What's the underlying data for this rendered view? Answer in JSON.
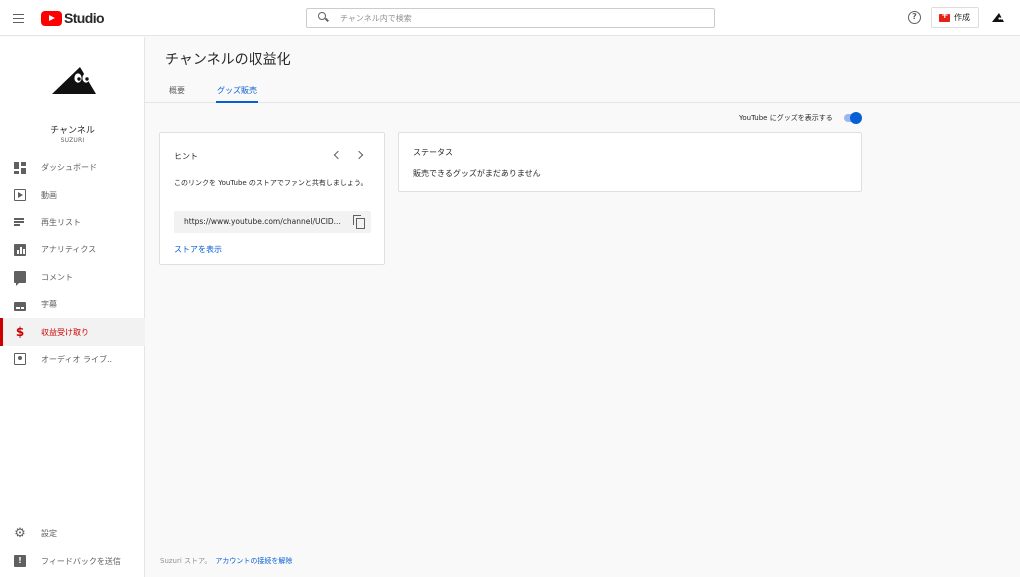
{
  "header": {
    "logo_text": "Studio",
    "search_placeholder": "チャンネル内で検索",
    "help_glyph": "?",
    "create_label": "作成"
  },
  "sidebar": {
    "channel_name": "チャンネル",
    "channel_handle": "SUZURI",
    "items": [
      {
        "label": "ダッシュボード",
        "icon": "dashboard-icon"
      },
      {
        "label": "動画",
        "icon": "video-icon"
      },
      {
        "label": "再生リスト",
        "icon": "playlist-icon"
      },
      {
        "label": "アナリティクス",
        "icon": "analytics-icon"
      },
      {
        "label": "コメント",
        "icon": "comment-icon"
      },
      {
        "label": "字幕",
        "icon": "subtitles-icon"
      },
      {
        "label": "収益受け取り",
        "icon": "dollar-icon",
        "active": true
      },
      {
        "label": "オーディオ ライブ..",
        "icon": "audio-library-icon"
      }
    ],
    "bottom_items": [
      {
        "label": "設定",
        "icon": "gear-icon"
      },
      {
        "label": "フィードバックを送信",
        "icon": "feedback-icon"
      }
    ]
  },
  "main": {
    "title": "チャンネルの収益化",
    "tabs": [
      {
        "label": "概要",
        "active": false
      },
      {
        "label": "グッズ販売",
        "active": true
      }
    ],
    "toggle": {
      "label": "YouTube にグッズを表示する",
      "on": true
    },
    "hint_card": {
      "title": "ヒント",
      "text": "このリンクを YouTube のストアでファンと共有しましょう。",
      "url": "https://www.youtube.com/channel/UCID...",
      "link": "ストアを表示"
    },
    "status_card": {
      "title": "ステータス",
      "text": "販売できるグッズがまだありません"
    }
  },
  "footer": {
    "text": "Suzuri ストア。",
    "link": "アカウントの接続を解除"
  },
  "colors": {
    "brand_red": "#ff0000",
    "active_red": "#cc0000",
    "link_blue": "#065fd4"
  }
}
